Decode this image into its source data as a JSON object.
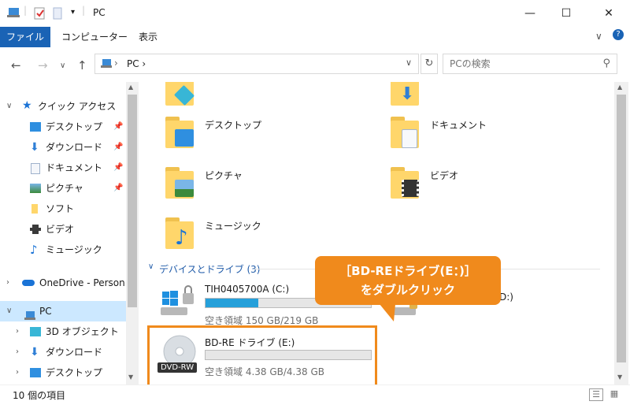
{
  "window": {
    "title": "PC",
    "minimize": "—",
    "maximize": "☐",
    "close": "✕"
  },
  "ribbon": {
    "file": "ファイル",
    "computer": "コンピューター",
    "view": "表示",
    "expand_chevron": "∨",
    "help": "?"
  },
  "nav": {
    "back": "←",
    "forward": "→",
    "history": "∨",
    "up": "↑",
    "address_text": "PC  ›",
    "address_dropdown": "∨",
    "refresh": "↻",
    "search_placeholder": "PCの検索"
  },
  "sidebar": {
    "quick_access": "クイック アクセス",
    "items": [
      {
        "label": "デスクトップ",
        "icon": "desktop-icon",
        "pinned": true
      },
      {
        "label": "ダウンロード",
        "icon": "download-icon",
        "pinned": true
      },
      {
        "label": "ドキュメント",
        "icon": "documents-icon",
        "pinned": true
      },
      {
        "label": "ピクチャ",
        "icon": "pictures-icon",
        "pinned": true
      },
      {
        "label": "ソフト",
        "icon": "folder-icon",
        "pinned": false
      },
      {
        "label": "ビデオ",
        "icon": "video-icon",
        "pinned": false
      },
      {
        "label": "ミュージック",
        "icon": "music-icon",
        "pinned": false
      }
    ],
    "onedrive": "OneDrive - Person",
    "pc": "PC",
    "pc_children": [
      {
        "label": "3D オブジェクト",
        "icon": "3d-objects-icon"
      },
      {
        "label": "ダウンロード",
        "icon": "download-icon"
      },
      {
        "label": "デスクトップ",
        "icon": "desktop-icon"
      }
    ]
  },
  "folders": [
    {
      "label": "デスクトップ",
      "icon": "desktop-folder-icon"
    },
    {
      "label": "ドキュメント",
      "icon": "documents-folder-icon"
    },
    {
      "label": "ピクチャ",
      "icon": "pictures-folder-icon"
    },
    {
      "label": "ビデオ",
      "icon": "video-folder-icon"
    },
    {
      "label": "ミュージック",
      "icon": "music-folder-icon"
    }
  ],
  "devices": {
    "group_title": "デバイスとドライブ (3)",
    "drives": [
      {
        "name": "TIH0405700A (C:)",
        "free": "空き領域 150 GB/219 GB",
        "used_fraction": 0.32,
        "icon": "windows-drive-icon"
      },
      {
        "name": "BD-RE ドライブ (E:)",
        "free": "空き領域 4.38 GB/4.38 GB",
        "used_fraction": 0.0,
        "icon": "dvd-drive-icon",
        "badge": "DVD-RW"
      }
    ],
    "partial_drive_suffix": "D:)"
  },
  "callout": {
    "line1": "［BD-REドライブ(E：)］",
    "line2": "をダブルクリック",
    "color": "#f08a1c"
  },
  "status": {
    "item_count": "10 個の項目"
  },
  "colors": {
    "accent": "#1a63b5",
    "drive_fill": "#26a0da",
    "group_title": "#1e5aa8"
  }
}
